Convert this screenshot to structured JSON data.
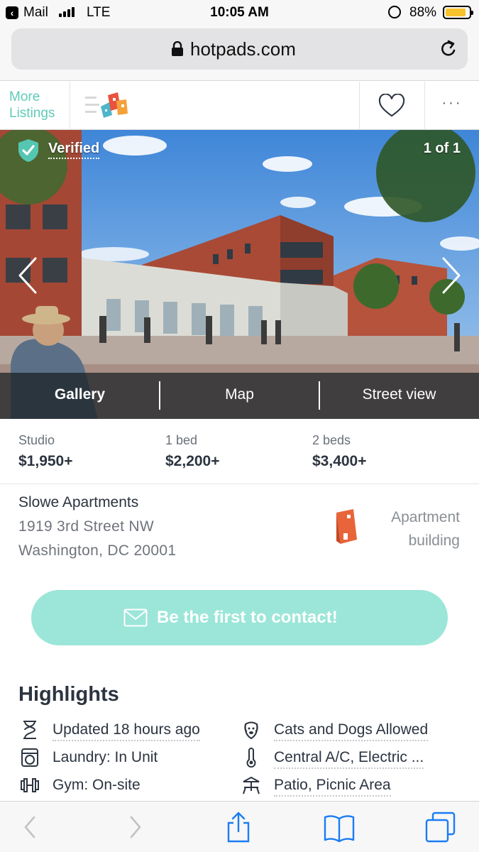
{
  "status_bar": {
    "carrier_back": "Mail",
    "network": "LTE",
    "time": "10:05 AM",
    "battery_percent": "88%",
    "battery_level": 0.88
  },
  "browser": {
    "url": "hotpads.com"
  },
  "header": {
    "more_listings_line1": "More",
    "more_listings_line2": "Listings",
    "logo_icon": "hotpads-logo-icon",
    "favorite_icon": "heart-icon",
    "menu_icon": "more-dots-icon",
    "menu_text": "···"
  },
  "photo": {
    "verified_label": "Verified",
    "counter": "1 of 1",
    "tabs": [
      {
        "label": "Gallery",
        "active": true
      },
      {
        "label": "Map",
        "active": false
      },
      {
        "label": "Street view",
        "active": false
      }
    ]
  },
  "prices": [
    {
      "label": "Studio",
      "value": "$1,950+"
    },
    {
      "label": "1 bed",
      "value": "$2,200+"
    },
    {
      "label": "2 beds",
      "value": "$3,400+"
    }
  ],
  "address": {
    "name": "Slowe Apartments",
    "street": "1919 3rd Street NW",
    "city": "Washington, DC 20001",
    "building_type_line1": "Apartment",
    "building_type_line2": "building"
  },
  "contact": {
    "label": "Be the first to contact!",
    "icon": "envelope-icon"
  },
  "highlights": {
    "title": "Highlights",
    "items": [
      {
        "label": "Updated 18 hours ago",
        "icon": "hourglass-icon"
      },
      {
        "label": "Cats and Dogs Allowed",
        "icon": "dog-icon"
      },
      {
        "label": "Laundry: In Unit",
        "icon": "washer-icon"
      },
      {
        "label": "Central A/C, Electric ...",
        "icon": "thermometer-icon"
      },
      {
        "label": "Gym: On-site",
        "icon": "dumbbell-icon"
      },
      {
        "label": "Patio, Picnic Area",
        "icon": "picnic-table-icon"
      }
    ]
  },
  "colors": {
    "accent": "#5fcbb7",
    "contact_button": "#9be6d8",
    "ios_blue": "#1a7cf5",
    "text_dark": "#2c3440"
  }
}
